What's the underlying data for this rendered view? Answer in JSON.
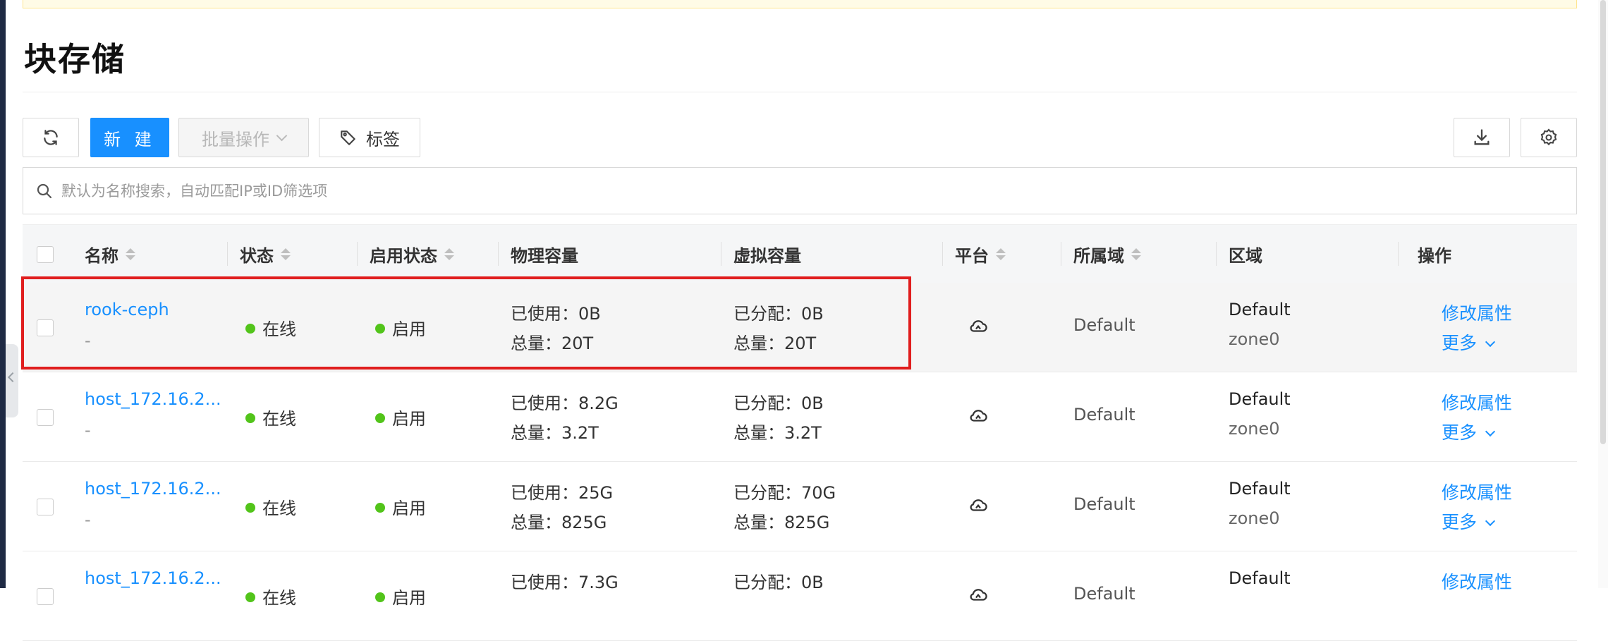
{
  "page": {
    "title": "块存储"
  },
  "toolbar": {
    "new_label": "新 建",
    "batch_label": "批量操作",
    "tag_label": "标签"
  },
  "search": {
    "placeholder": "默认为名称搜索，自动匹配IP或ID筛选项"
  },
  "table": {
    "columns": {
      "name": "名称",
      "status": "状态",
      "enabled": "启用状态",
      "physical": "物理容量",
      "virtual": "虚拟容量",
      "platform": "平台",
      "domain": "所属域",
      "region": "区域",
      "actions": "操作"
    },
    "rows": [
      {
        "name": "rook-ceph",
        "desc": "-",
        "status": "在线",
        "enabled": "启用",
        "phys_used": "已使用：0B",
        "phys_total": "总量：20T",
        "virt_alloc": "已分配：0B",
        "virt_total": "总量：20T",
        "domain": "Default",
        "region": "Default",
        "zone": "zone0",
        "edit": "修改属性",
        "more": "更多"
      },
      {
        "name": "host_172.16.2...",
        "desc": "-",
        "status": "在线",
        "enabled": "启用",
        "phys_used": "已使用：8.2G",
        "phys_total": "总量：3.2T",
        "virt_alloc": "已分配：0B",
        "virt_total": "总量：3.2T",
        "domain": "Default",
        "region": "Default",
        "zone": "zone0",
        "edit": "修改属性",
        "more": "更多"
      },
      {
        "name": "host_172.16.2...",
        "desc": "-",
        "status": "在线",
        "enabled": "启用",
        "phys_used": "已使用：25G",
        "phys_total": "总量：825G",
        "virt_alloc": "已分配：70G",
        "virt_total": "总量：825G",
        "domain": "Default",
        "region": "Default",
        "zone": "zone0",
        "edit": "修改属性",
        "more": "更多"
      },
      {
        "name": "host_172.16.2...",
        "desc": "",
        "status": "在线",
        "enabled": "启用",
        "phys_used": "已使用：7.3G",
        "phys_total": "",
        "virt_alloc": "已分配：0B",
        "virt_total": "",
        "domain": "Default",
        "region": "Default",
        "zone": "",
        "edit": "修改属性",
        "more": ""
      }
    ]
  },
  "colors": {
    "primary": "#1890ff",
    "online": "#52c41a",
    "highlight": "#e01e1e"
  },
  "icons": [
    "refresh-icon",
    "tag-icon",
    "download-icon",
    "settings-icon",
    "search-icon",
    "cloud-platform-icon",
    "chevron-down-icon"
  ]
}
